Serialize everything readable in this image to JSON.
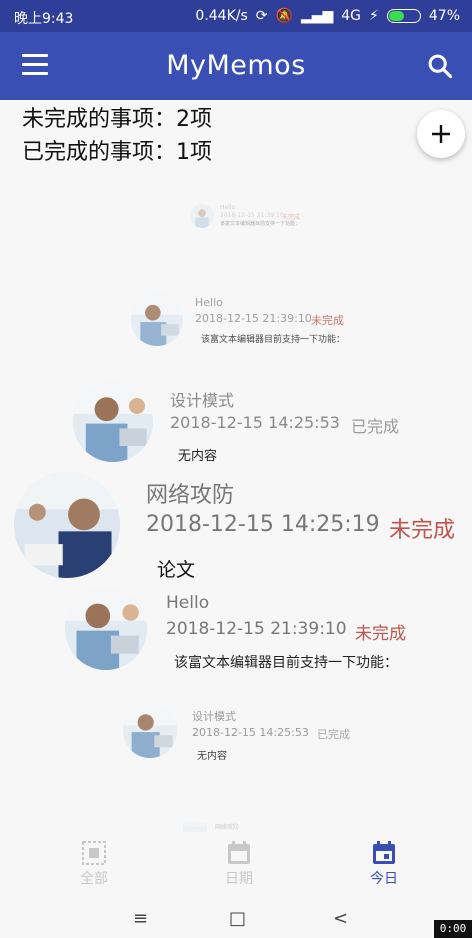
{
  "status_bar": {
    "time": "晚上9:43",
    "speed": "0.44K/s",
    "network": "4G",
    "battery": "47%",
    "battery_level": 0.47
  },
  "app_bar": {
    "title": "MyMemos",
    "menu_icon": "menu-icon",
    "search_icon": "search-icon"
  },
  "summary": {
    "undone": "未完成的事项：2项",
    "done": "已完成的事项：1项"
  },
  "fab": {
    "icon": "plus-icon"
  },
  "memos": [
    {
      "title": "Hello",
      "date": "2018-12-15 21:39:10",
      "status": "未完成",
      "body": "该富文本编辑器目前支持一下功能："
    },
    {
      "title": "Hello",
      "date": "2018-12-15 21:39:10",
      "status": "未完成",
      "body": "该富文本编辑器目前支持一下功能："
    },
    {
      "title": "设计模式",
      "date": "2018-12-15 14:25:53",
      "status": "已完成",
      "body": "无内容"
    },
    {
      "title": "网络攻防",
      "date": "2018-12-15 14:25:19",
      "status": "未完成",
      "body": "论文"
    },
    {
      "title": "Hello",
      "date": "2018-12-15 21:39:10",
      "status": "未完成",
      "body": "该富文本编辑器目前支持一下功能："
    },
    {
      "title": "设计模式",
      "date": "2018-12-15 14:25:53",
      "status": "已完成",
      "body": "无内容"
    },
    {
      "title": "网络攻防"
    }
  ],
  "bottom_nav": {
    "items": [
      {
        "label": "全部",
        "icon": "all-grid-icon"
      },
      {
        "label": "日期",
        "icon": "calendar-icon"
      },
      {
        "label": "今日",
        "icon": "today-calendar-icon",
        "active": true
      }
    ]
  },
  "system_nav": {
    "menu": "≡",
    "home": "□",
    "back": "<"
  },
  "corner_overlay": "0:00",
  "colors": {
    "primary": "#3a4fb3",
    "status_bar": "#2f3f99",
    "undone": "#c3544d"
  }
}
